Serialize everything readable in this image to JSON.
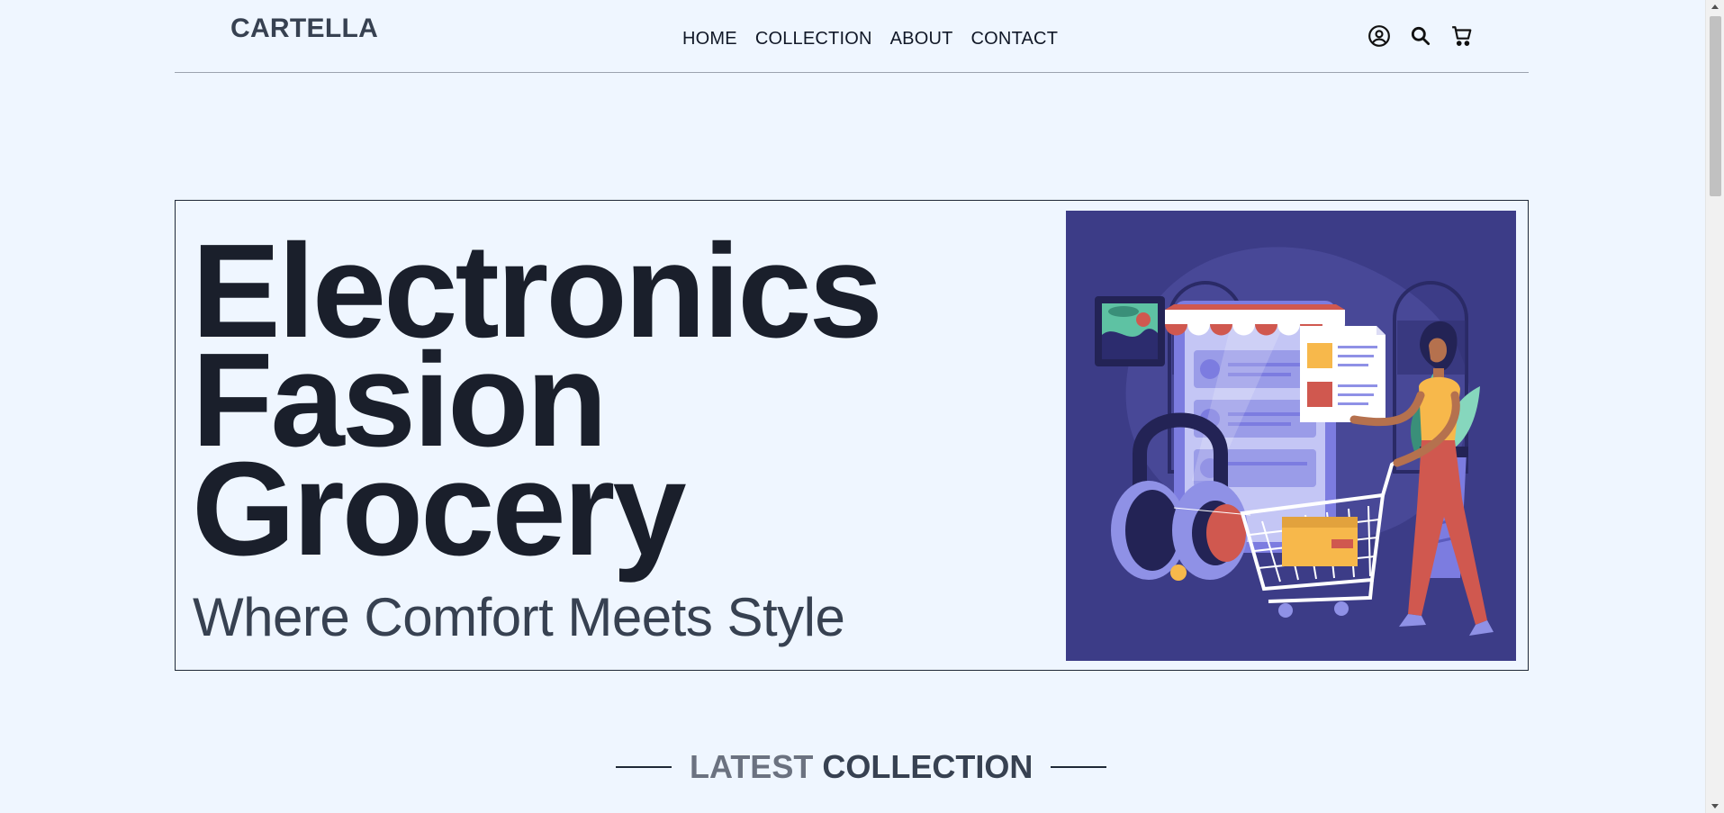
{
  "header": {
    "logo": "CARTELLA",
    "nav": [
      {
        "label": "HOME"
      },
      {
        "label": "COLLECTION"
      },
      {
        "label": "ABOUT"
      },
      {
        "label": "CONTACT"
      }
    ],
    "icons": [
      "user-icon",
      "search-icon",
      "cart-icon"
    ]
  },
  "hero": {
    "heading_lines": [
      "Electronics",
      "Fasion",
      "Grocery"
    ],
    "subheading": "Where Comfort Meets Style",
    "illustration": "shopping-illustration",
    "colors": {
      "illustration_bg": "#3c3c87",
      "accent_red": "#d0584f",
      "accent_yellow": "#f7b84b"
    }
  },
  "section": {
    "title_part1": "LATEST",
    "title_part2": "COLLECTION"
  }
}
